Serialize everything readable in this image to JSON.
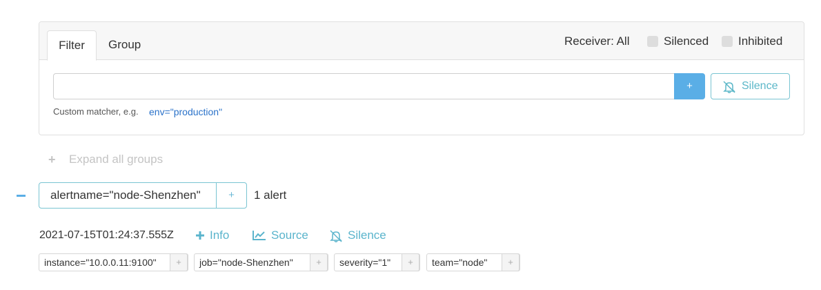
{
  "tabs": {
    "filter_label": "Filter",
    "group_label": "Group"
  },
  "header": {
    "receiver_label": "Receiver: All",
    "silenced_label": "Silenced",
    "inhibited_label": "Inhibited"
  },
  "filter": {
    "input_value": "",
    "add_button_label": "+",
    "silence_button_label": "Silence",
    "hint_text": "Custom matcher, e.g.",
    "hint_example": "env=\"production\""
  },
  "expand_all": {
    "icon": "+",
    "label": "Expand all groups"
  },
  "group": {
    "collapse_icon": "minus-icon",
    "label": "alertname=\"node-Shenzhen\"",
    "add_label": "+",
    "count_text": "1 alert"
  },
  "alert": {
    "timestamp": "2021-07-15T01:24:37.555Z",
    "info_label": "Info",
    "source_label": "Source",
    "silence_label": "Silence",
    "labels": [
      {
        "text": "instance=\"10.0.0.11:9100\"",
        "add": "+"
      },
      {
        "text": "job=\"node-Shenzhen\"",
        "add": "+"
      },
      {
        "text": "severity=\"1\"",
        "add": "+"
      },
      {
        "text": "team=\"node\"",
        "add": "+"
      }
    ]
  },
  "colors": {
    "accent_blue": "#5aaee6",
    "teal": "#5bb7c8",
    "link_blue": "#2a72c9",
    "muted": "#c4c4c4"
  }
}
